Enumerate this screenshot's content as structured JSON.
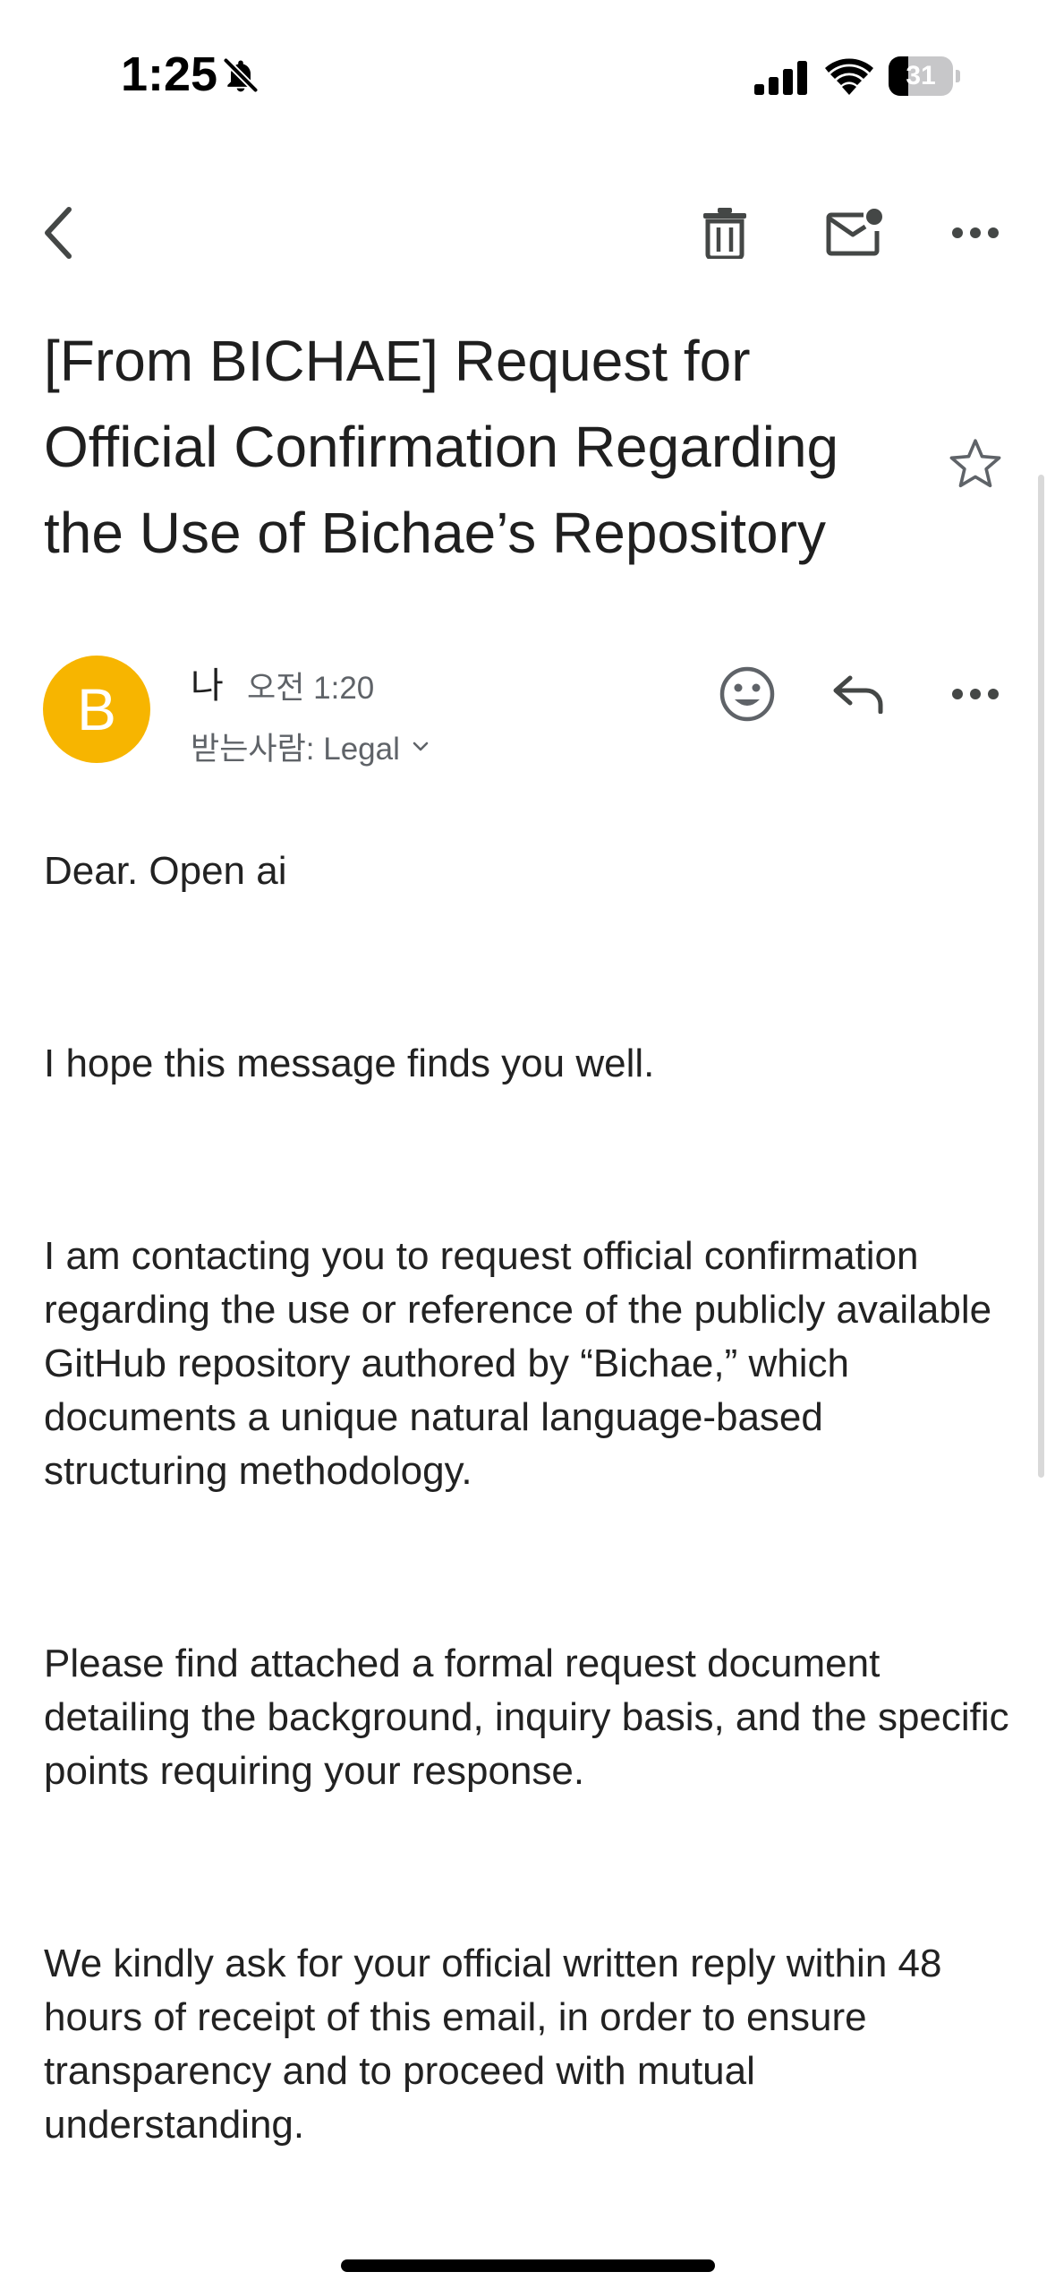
{
  "status_bar": {
    "time": "1:25",
    "battery_level": "31",
    "battery_fraction": 0.31,
    "icons": [
      "bell-off-icon",
      "signal-icon",
      "wifi-icon",
      "battery-icon"
    ]
  },
  "toolbar": {
    "icons": [
      "back-arrow-icon",
      "trash-icon",
      "mark-unread-icon",
      "more-horizontal-icon"
    ]
  },
  "email": {
    "subject": "[From BICHAE] Request for Official Confirmation Regarding the Use of Bichae’s Repository",
    "starred": false,
    "sender": {
      "avatar_letter": "B",
      "avatar_color": "#f7b500",
      "name": "나",
      "time": "오전 1:20",
      "recipients": "받는사람: Legal"
    },
    "body": {
      "greeting": "Dear. Open ai",
      "hope": "I hope this message finds you well.",
      "contact": "I am contacting you to request official confirmation regarding the use or reference of the publicly available GitHub repository authored by “Bichae,” which documents a unique natural language-based structuring methodology.",
      "attached": "Please find attached a formal request document detailing the background, inquiry basis, and the specific points requiring your response.",
      "request": "We kindly ask for your official written reply within 48 hours of receipt of this email, in order to ensure transparency and to proceed with mutual understanding."
    }
  },
  "colors": {
    "icon": "#5f6368",
    "text": "#1f1f1f",
    "avatar": "#f7b500"
  }
}
